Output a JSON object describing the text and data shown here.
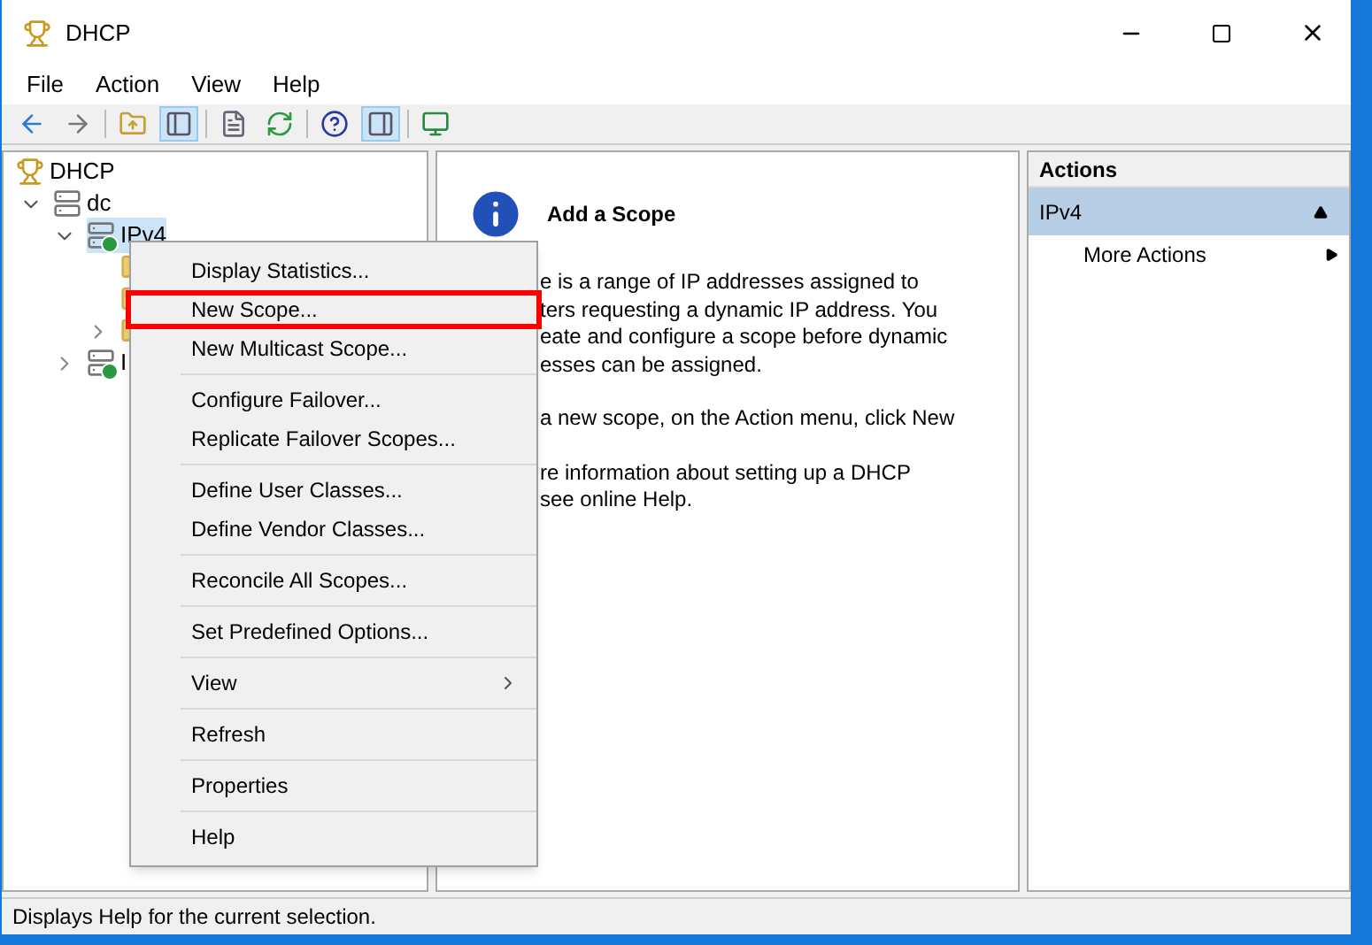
{
  "window": {
    "title": "DHCP"
  },
  "menu_bar": [
    "File",
    "Action",
    "View",
    "Help"
  ],
  "toolbar": [
    {
      "pressed": false
    },
    {
      "pressed": false
    },
    {
      "pressed": false
    },
    {
      "pressed": true
    },
    {
      "pressed": false
    },
    {
      "pressed": false
    },
    {
      "pressed": false
    },
    {
      "pressed": true
    },
    {
      "pressed": false
    }
  ],
  "tree": [
    {
      "label": "DHCP",
      "kind": "root",
      "selected": false,
      "children": [
        {
          "label": "dc",
          "kind": "server",
          "expanded": true,
          "selected": false,
          "children": [
            {
              "label": "IPv4",
              "kind": "scope",
              "expanded": true,
              "selected": true,
              "children": [
                {
                  "kind": "folder"
                },
                {
                  "kind": "folder"
                },
                {
                  "kind": "folder",
                  "expanded": false
                }
              ]
            },
            {
              "label": "I",
              "kind": "scope",
              "expanded": false,
              "selected": false
            }
          ]
        }
      ]
    }
  ],
  "content": {
    "title": "Add a Scope",
    "paragraphs": [
      [
        "e is a range of IP addresses assigned to",
        "ters requesting a dynamic IP address. You",
        "eate and configure a scope before dynamic",
        "esses can be assigned."
      ],
      [
        "a new scope, on the Action menu, click New"
      ],
      [
        "re information about setting up a DHCP",
        "see online Help."
      ]
    ]
  },
  "actions": {
    "title": "Actions",
    "section": "IPv4",
    "expanded": true,
    "items": [
      {
        "label": "More Actions",
        "submenu": true
      }
    ]
  },
  "context_menu": [
    [
      {
        "label": "Display Statistics...",
        "highlighted": false
      },
      {
        "label": "New Scope...",
        "highlighted": true
      },
      {
        "label": "New Multicast Scope...",
        "highlighted": false
      }
    ],
    [
      {
        "label": "Configure Failover...",
        "highlighted": false
      },
      {
        "label": "Replicate Failover Scopes...",
        "highlighted": false
      }
    ],
    [
      {
        "label": "Define User Classes...",
        "highlighted": false
      },
      {
        "label": "Define Vendor Classes...",
        "highlighted": false
      }
    ],
    [
      {
        "label": "Reconcile All Scopes...",
        "highlighted": false
      }
    ],
    [
      {
        "label": "Set Predefined Options...",
        "highlighted": false
      }
    ],
    [
      {
        "label": "View",
        "highlighted": false,
        "submenu": true
      }
    ],
    [
      {
        "label": "Refresh",
        "highlighted": false
      }
    ],
    [
      {
        "label": "Properties",
        "highlighted": false
      }
    ],
    [
      {
        "label": "Help",
        "highlighted": false
      }
    ]
  ],
  "status_bar": "Displays Help for the current selection."
}
